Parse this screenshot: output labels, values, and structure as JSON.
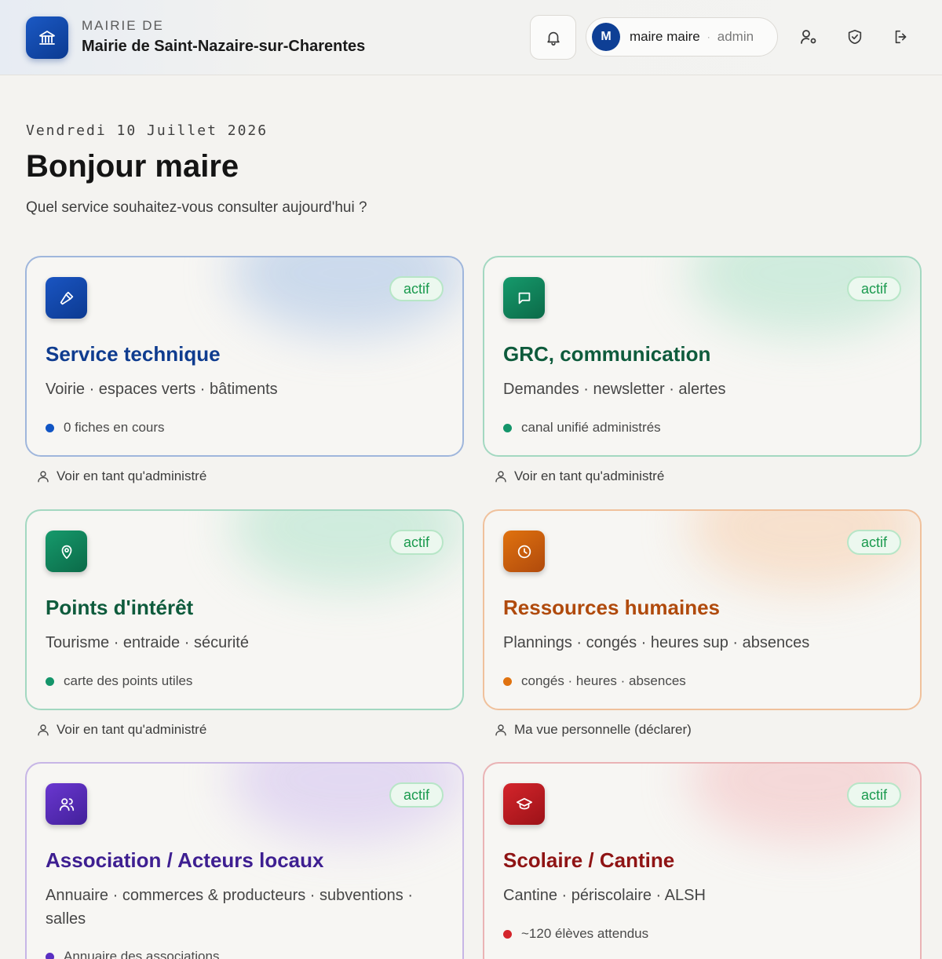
{
  "header": {
    "kicker": "MAIRIE DE",
    "title": "Mairie de Saint-Nazaire-sur-Charentes",
    "user": {
      "initial": "M",
      "name": "maire maire",
      "separator": "·",
      "role": "admin"
    }
  },
  "greeting": {
    "date": "Vendredi 10 Juillet 2026",
    "title": "Bonjour maire",
    "subtitle": "Quel service souhaitez-vous consulter aujourd'hui ?"
  },
  "cards": [
    {
      "title": "Service technique",
      "desc": "Voirie · espaces verts · bâtiments",
      "meta": "0 fiches en cours",
      "badge": "actif",
      "link": "Voir en tant qu'administré",
      "color": "#0f3c8f",
      "dot": "#1155c4",
      "icon": "hammer-icon"
    },
    {
      "title": "GRC, communication",
      "desc": "Demandes · newsletter · alertes",
      "meta": "canal unifié administrés",
      "badge": "actif",
      "link": "Voir en tant qu'administré",
      "color": "#0e5b3c",
      "dot": "#14956a",
      "icon": "chat-bubble-icon"
    },
    {
      "title": "Points d'intérêt",
      "desc": "Tourisme · entraide · sécurité",
      "meta": "carte des points utiles",
      "badge": "actif",
      "link": "Voir en tant qu'administré",
      "color": "#0e5b3c",
      "dot": "#14956a",
      "icon": "map-pin-icon"
    },
    {
      "title": "Ressources humaines",
      "desc": "Plannings · congés · heures sup · absences",
      "meta": "congés · heures · absences",
      "badge": "actif",
      "link": "Ma vue personnelle (déclarer)",
      "color": "#b04a0c",
      "dot": "#e0720f",
      "icon": "clock-icon"
    },
    {
      "title": "Association / Acteurs locaux",
      "desc": "Annuaire · commerces & producteurs · subventions · salles",
      "meta": "Annuaire des associations",
      "badge": "actif",
      "link": "",
      "color": "#3e1f91",
      "dot": "#5a2fc2",
      "icon": "users-icon"
    },
    {
      "title": "Scolaire / Cantine",
      "desc": "Cantine · périscolaire · ALSH",
      "meta": "~120 élèves attendus",
      "badge": "actif",
      "link": "",
      "color": "#8f1414",
      "dot": "#d4252b",
      "icon": "graduation-cap-icon"
    }
  ]
}
